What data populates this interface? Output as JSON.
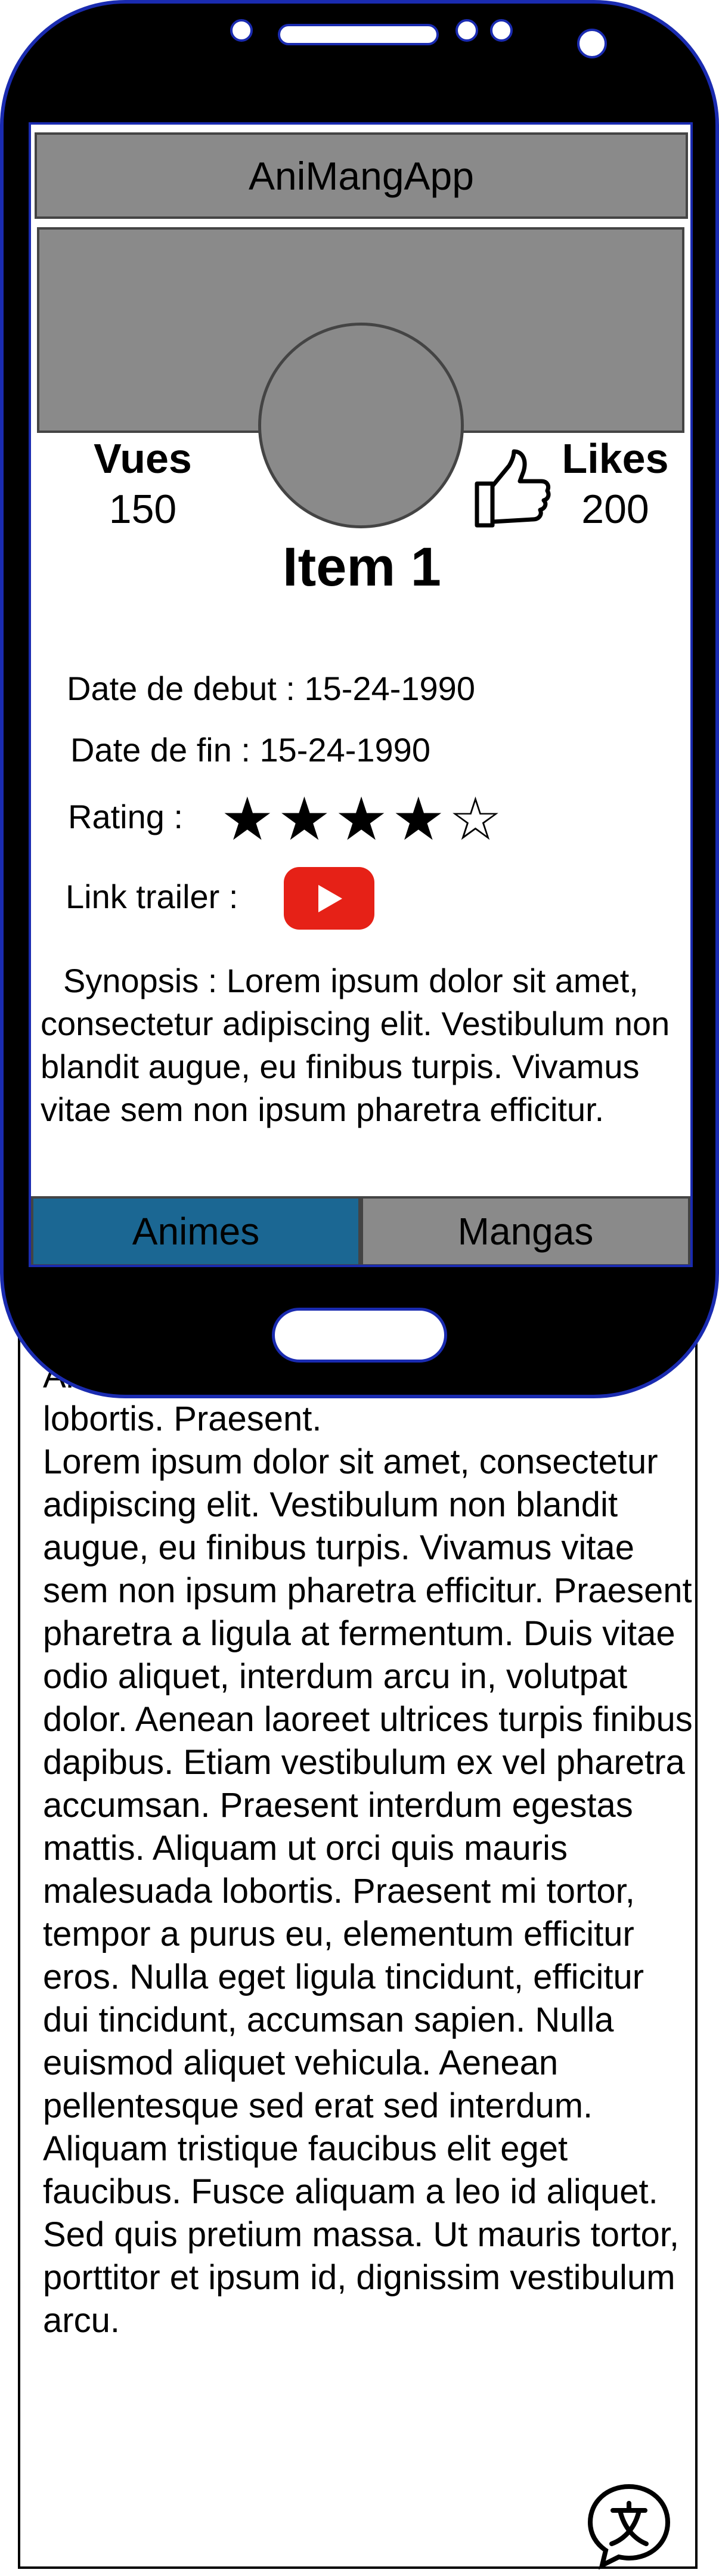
{
  "app": {
    "title": "AniMangApp"
  },
  "item": {
    "title": "Item 1",
    "views_label": "Vues",
    "views_value": "150",
    "likes_label": "Likes",
    "likes_value": "200",
    "start_date": "Date de debut : 15-24-1990",
    "end_date": "Date de fin : 15-24-1990",
    "rating_label": "Rating :",
    "rating": {
      "value": 4,
      "max": 5,
      "stars_text": "★★★★☆"
    },
    "trailer_label": "Link trailer :",
    "synopsis_label": "Synopsis :",
    "synopsis_visible": " Lorem ipsum dolor sit amet, consectetur adipiscing elit. Vestibulum non blandit augue, eu finibus turpis. Vivamus vitae sem non ipsum pharetra efficitur. Praesent pharetra a ligula at fermentum.",
    "synopsis_overflow": "Aliquam ut orci quis mauris malesuada lobortis. Praesent.\nLorem ipsum dolor sit amet, consectetur adipiscing elit. Vestibulum non blandit augue, eu finibus turpis. Vivamus vitae sem non ipsum pharetra efficitur. Praesent pharetra a ligula at fermentum. Duis vitae odio aliquet, interdum arcu in, volutpat dolor. Aenean laoreet ultrices turpis finibus dapibus. Etiam vestibulum ex vel pharetra accumsan. Praesent interdum egestas mattis. Aliquam ut orci quis mauris malesuada lobortis. Praesent mi tortor, tempor a purus eu, elementum efficitur eros. Nulla eget ligula tincidunt, efficitur dui tincidunt, accumsan sapien. Nulla euismod aliquet vehicula. Aenean pellentesque sed erat sed interdum. Aliquam tristique faucibus elit eget faucibus. Fusce aliquam a leo id aliquet. Sed quis pretium massa. Ut mauris tortor, porttitor et ipsum id, dignissim vestibulum arcu."
  },
  "tabs": [
    {
      "label": "Animes",
      "active": true
    },
    {
      "label": "Mangas",
      "active": false
    }
  ],
  "icons": {
    "like": "thumbs-up-icon",
    "trailer": "youtube-play-icon",
    "translate": "translate-chat-icon"
  },
  "colors": {
    "phone_body": "#000000",
    "phone_outline": "#1a2bb0",
    "placeholder_gray": "#8a8a8a",
    "tab_active": "#1b6793",
    "youtube_red": "#e62117"
  }
}
